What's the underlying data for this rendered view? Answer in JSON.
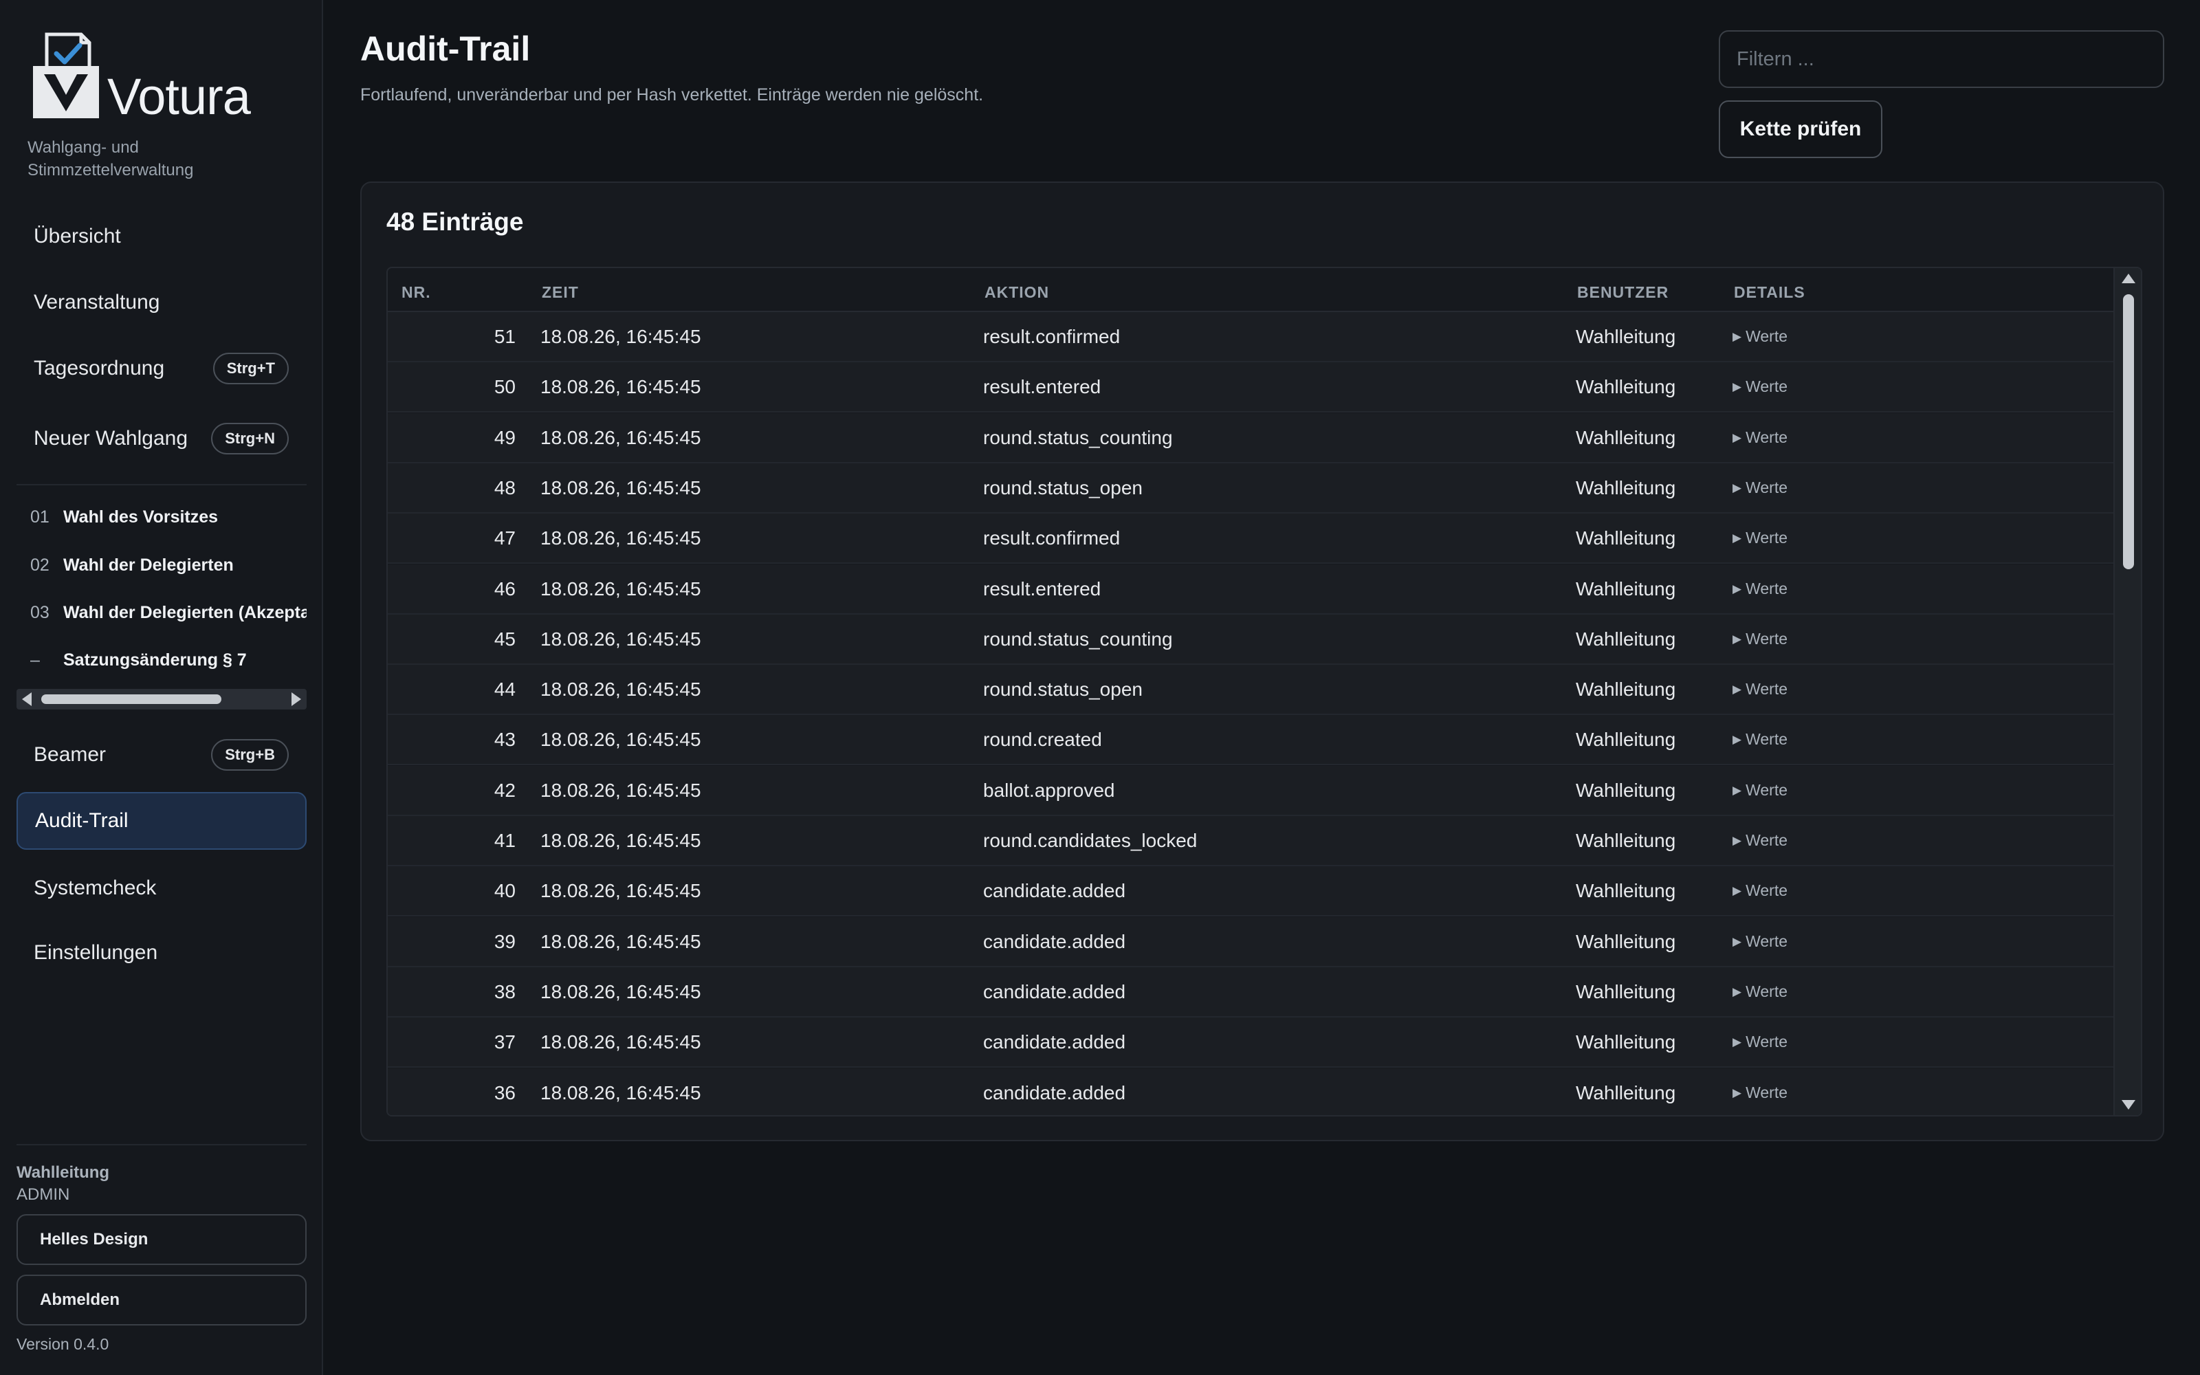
{
  "app": {
    "name": "Votura",
    "tagline": "Wahlgang- und Stimmzettelverwaltung"
  },
  "nav": {
    "overview": "Übersicht",
    "event": "Veranstaltung",
    "agenda": {
      "label": "Tagesordnung",
      "shortcut": "Strg+T"
    },
    "new_round": {
      "label": "Neuer Wahlgang",
      "shortcut": "Strg+N"
    },
    "beamer": {
      "label": "Beamer",
      "shortcut": "Strg+B"
    },
    "audit": "Audit-Trail",
    "systemcheck": "Systemcheck",
    "settings": "Einstellungen"
  },
  "agenda_items": [
    {
      "num": "01",
      "title": "Wahl des Vorsitzes"
    },
    {
      "num": "02",
      "title": "Wahl der Delegierten"
    },
    {
      "num": "03",
      "title": "Wahl der Delegierten (Akzeptanz)"
    },
    {
      "num": "–",
      "title": "Satzungsänderung § 7"
    }
  ],
  "user": {
    "name": "Wahlleitung",
    "role": "ADMIN"
  },
  "buttons": {
    "theme": "Helles Design",
    "logout": "Abmelden",
    "verify": "Kette prüfen"
  },
  "version": "Version 0.4.0",
  "page": {
    "title": "Audit-Trail",
    "subtitle": "Fortlaufend, unveränderbar und per Hash verkettet. Einträge werden nie gelöscht.",
    "filter_placeholder": "Filtern ..."
  },
  "card": {
    "title": "48 Einträge"
  },
  "table": {
    "columns": [
      "NR.",
      "ZEIT",
      "AKTION",
      "BENUTZER",
      "DETAILS"
    ],
    "rows": [
      {
        "nr": "51",
        "zeit": "18.08.26, 16:45:45",
        "aktion": "result.confirmed",
        "benutzer": "Wahlleitung",
        "details": "Werte"
      },
      {
        "nr": "50",
        "zeit": "18.08.26, 16:45:45",
        "aktion": "result.entered",
        "benutzer": "Wahlleitung",
        "details": "Werte"
      },
      {
        "nr": "49",
        "zeit": "18.08.26, 16:45:45",
        "aktion": "round.status_counting",
        "benutzer": "Wahlleitung",
        "details": "Werte"
      },
      {
        "nr": "48",
        "zeit": "18.08.26, 16:45:45",
        "aktion": "round.status_open",
        "benutzer": "Wahlleitung",
        "details": "Werte"
      },
      {
        "nr": "47",
        "zeit": "18.08.26, 16:45:45",
        "aktion": "result.confirmed",
        "benutzer": "Wahlleitung",
        "details": "Werte"
      },
      {
        "nr": "46",
        "zeit": "18.08.26, 16:45:45",
        "aktion": "result.entered",
        "benutzer": "Wahlleitung",
        "details": "Werte"
      },
      {
        "nr": "45",
        "zeit": "18.08.26, 16:45:45",
        "aktion": "round.status_counting",
        "benutzer": "Wahlleitung",
        "details": "Werte"
      },
      {
        "nr": "44",
        "zeit": "18.08.26, 16:45:45",
        "aktion": "round.status_open",
        "benutzer": "Wahlleitung",
        "details": "Werte"
      },
      {
        "nr": "43",
        "zeit": "18.08.26, 16:45:45",
        "aktion": "round.created",
        "benutzer": "Wahlleitung",
        "details": "Werte"
      },
      {
        "nr": "42",
        "zeit": "18.08.26, 16:45:45",
        "aktion": "ballot.approved",
        "benutzer": "Wahlleitung",
        "details": "Werte"
      },
      {
        "nr": "41",
        "zeit": "18.08.26, 16:45:45",
        "aktion": "round.candidates_locked",
        "benutzer": "Wahlleitung",
        "details": "Werte"
      },
      {
        "nr": "40",
        "zeit": "18.08.26, 16:45:45",
        "aktion": "candidate.added",
        "benutzer": "Wahlleitung",
        "details": "Werte"
      },
      {
        "nr": "39",
        "zeit": "18.08.26, 16:45:45",
        "aktion": "candidate.added",
        "benutzer": "Wahlleitung",
        "details": "Werte"
      },
      {
        "nr": "38",
        "zeit": "18.08.26, 16:45:45",
        "aktion": "candidate.added",
        "benutzer": "Wahlleitung",
        "details": "Werte"
      },
      {
        "nr": "37",
        "zeit": "18.08.26, 16:45:45",
        "aktion": "candidate.added",
        "benutzer": "Wahlleitung",
        "details": "Werte"
      },
      {
        "nr": "36",
        "zeit": "18.08.26, 16:45:45",
        "aktion": "candidate.added",
        "benutzer": "Wahlleitung",
        "details": "Werte"
      }
    ]
  },
  "colors": {
    "background": "#111418",
    "sidebar": "#15181d",
    "active_nav": "#1c2b43",
    "logo_accent": "#3b8fd6"
  }
}
